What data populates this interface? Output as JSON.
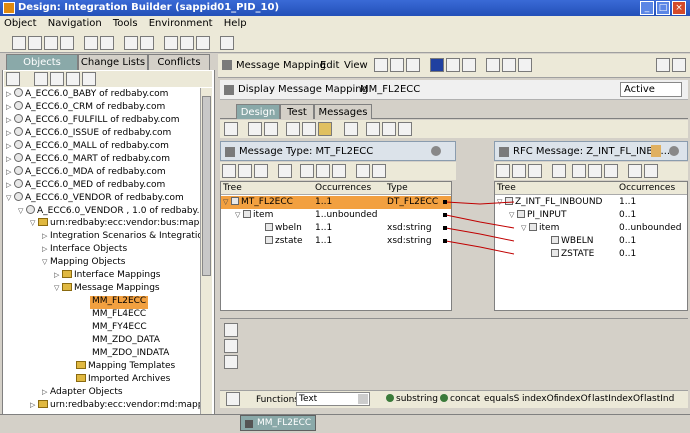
{
  "window": {
    "title": "Design: Integration Builder (sappid01_PID_10)"
  },
  "menu": [
    "Object",
    "Navigation",
    "Tools",
    "Environment",
    "Help"
  ],
  "left_tabs": [
    "Objects",
    "Change Lists",
    "Conflicts"
  ],
  "tree": [
    {
      "label": "A_ECC6.0_BABY of redbaby.com"
    },
    {
      "label": "A_ECC6.0_CRM of redbaby.com"
    },
    {
      "label": "A_ECC6.0_FULFILL of redbaby.com"
    },
    {
      "label": "A_ECC6.0_ISSUE of redbaby.com"
    },
    {
      "label": "A_ECC6.0_MALL of redbaby.com"
    },
    {
      "label": "A_ECC6.0_MART of redbaby.com"
    },
    {
      "label": "A_ECC6.0_MDA of redbaby.com"
    },
    {
      "label": "A_ECC6.0_MED of redbaby.com"
    },
    {
      "label": "A_ECC6.0_VENDOR of redbaby.com"
    },
    {
      "label": "A_ECC6.0_VENDOR , 1.0 of redbaby.c"
    },
    {
      "label": "urn:redbaby:ecc:vendor:bus:mapp"
    },
    {
      "label": "Integration Scenarios & Integration"
    },
    {
      "label": "Interface Objects"
    },
    {
      "label": "Mapping Objects"
    },
    {
      "label": "Interface Mappings"
    },
    {
      "label": "Message Mappings"
    },
    {
      "label": "MM_FL2ECC"
    },
    {
      "label": "MM_FL4ECC"
    },
    {
      "label": "MM_FY4ECC"
    },
    {
      "label": "MM_ZDO_DATA"
    },
    {
      "label": "MM_ZDO_INDATA"
    },
    {
      "label": "Mapping Templates"
    },
    {
      "label": "Imported Archives"
    },
    {
      "label": "Adapter Objects"
    },
    {
      "label": "urn:redbaby:ecc:vendor:md:mapp"
    }
  ],
  "editor": {
    "menu": [
      "Message Mapping",
      "Edit",
      "View"
    ],
    "header_title": "Display Message Mapping",
    "object_name": "MM_FL2ECC",
    "state": "Active",
    "tabs": [
      "Design",
      "Test",
      "Messages"
    ]
  },
  "source": {
    "title": "Message Type: MT_FL2ECC",
    "columns": [
      "Tree",
      "Occurrences",
      "Type"
    ],
    "rows": [
      {
        "name": "MT_FL2ECC",
        "occ": "1..1",
        "type": "DT_FL2ECC"
      },
      {
        "name": "item",
        "occ": "1..unbounded",
        "type": ""
      },
      {
        "name": "wbeln",
        "occ": "1..1",
        "type": "xsd:string"
      },
      {
        "name": "zstate",
        "occ": "1..1",
        "type": "xsd:string"
      }
    ]
  },
  "target": {
    "title": "RFC Message: Z_INT_FL_INBO...",
    "columns": [
      "Tree",
      "Occurrences"
    ],
    "rows": [
      {
        "name": "Z_INT_FL_INBOUND",
        "occ": "1..1"
      },
      {
        "name": "PI_INPUT",
        "occ": "0..1"
      },
      {
        "name": "item",
        "occ": "0..unbounded"
      },
      {
        "name": "WBELN",
        "occ": "0..1"
      },
      {
        "name": "ZSTATE",
        "occ": "0..1"
      }
    ]
  },
  "functions": {
    "label": "Functions:",
    "category": "Text",
    "items": [
      "substring",
      "concat",
      "equalsS",
      "indexOf",
      "indexOf",
      "lastIndexOf",
      "lastInd"
    ]
  },
  "bottom_tab": "MM_FL2ECC",
  "colors": {
    "title_bar": "#2350b8",
    "selected_row": "#f2a040",
    "mapping_line": "#c00000"
  }
}
